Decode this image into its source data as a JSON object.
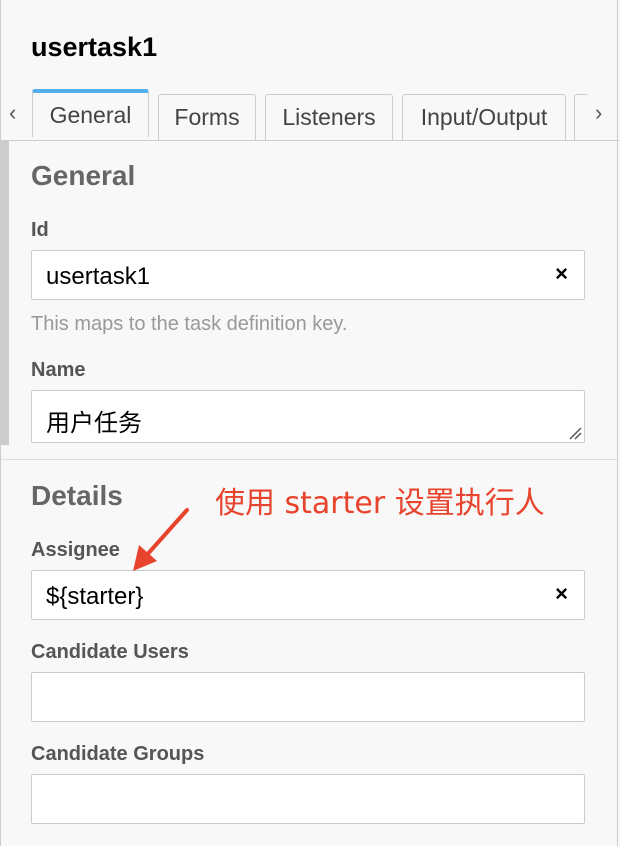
{
  "title": "usertask1",
  "nav": {
    "prev_icon": "‹",
    "next_icon": "›"
  },
  "tabs": [
    {
      "label": "General"
    },
    {
      "label": "Forms"
    },
    {
      "label": "Listeners"
    },
    {
      "label": "Input/Output"
    }
  ],
  "general": {
    "heading": "General",
    "id_label": "Id",
    "id_value": "usertask1",
    "id_hint": "This maps to the task definition key.",
    "name_label": "Name",
    "name_value": "用户任务"
  },
  "details": {
    "heading": "Details",
    "assignee_label": "Assignee",
    "assignee_value": "${starter}",
    "candidate_users_label": "Candidate Users",
    "candidate_users_value": "",
    "candidate_groups_label": "Candidate Groups",
    "candidate_groups_value": ""
  },
  "clear_icon": "×",
  "annotation": {
    "text": "使用 starter 设置执行人",
    "color": "#e8432c"
  }
}
